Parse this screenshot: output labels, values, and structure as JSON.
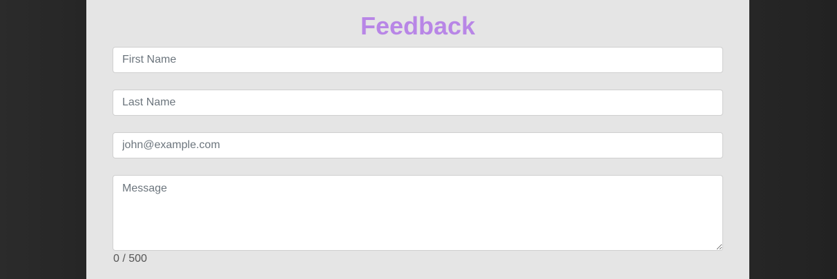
{
  "form": {
    "title": "Feedback",
    "first_name": {
      "value": "",
      "placeholder": "First Name"
    },
    "last_name": {
      "value": "",
      "placeholder": "Last Name"
    },
    "email": {
      "value": "",
      "placeholder": "john@example.com"
    },
    "message": {
      "value": "",
      "placeholder": "Message"
    },
    "char_counter": "0 / 500"
  },
  "colors": {
    "page_background": "#262626",
    "panel_background": "#e5e5e5",
    "title": "#b886e6",
    "field_background": "#ffffff",
    "field_border": "#cfcfcf",
    "placeholder": "#6c757d",
    "counter_text": "#555555"
  }
}
